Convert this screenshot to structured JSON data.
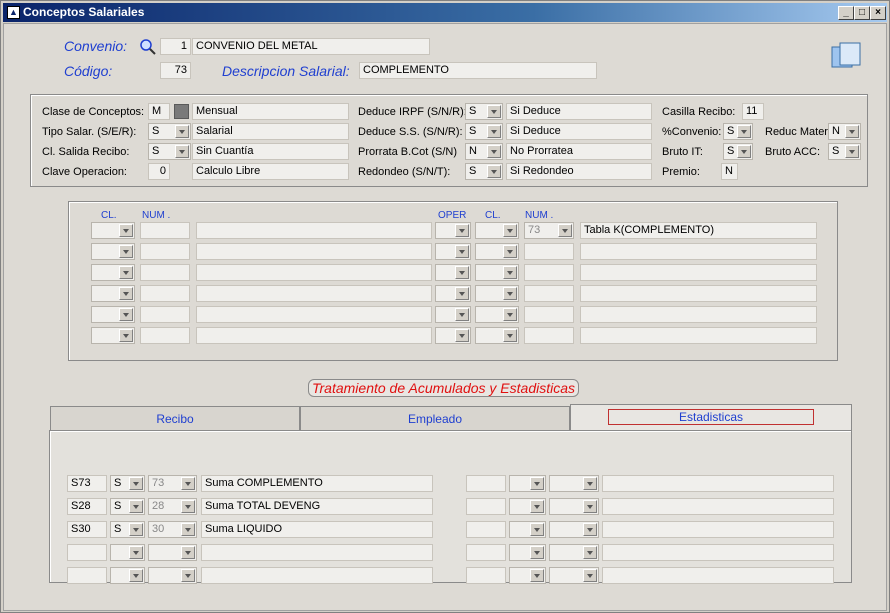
{
  "window": {
    "title": "Conceptos Salariales"
  },
  "header": {
    "convenio_label": "Convenio:",
    "convenio_code": "1",
    "convenio_name": "CONVENIO DEL METAL",
    "codigo_label": "Código:",
    "codigo_value": "73",
    "descripcion_label": "Descripcion Salarial:",
    "descripcion_value": "COMPLEMENTO"
  },
  "params": {
    "clase_label": "Clase de Conceptos:",
    "clase_value": "M",
    "clase_desc": "Mensual",
    "tipo_label": "Tipo Salar. (S/E/R):",
    "tipo_value": "S",
    "tipo_desc": "Salarial",
    "salida_label": "Cl. Salida Recibo:",
    "salida_value": "S",
    "salida_desc": "Sin Cuantía",
    "clave_label": "Clave Operacion:",
    "clave_value": "0",
    "clave_desc": "Calculo Libre",
    "irpf_label": "Deduce IRPF (S/N/R):",
    "irpf_value": "S",
    "irpf_desc": "Si Deduce",
    "ss_label": "Deduce S.S. (S/N/R):",
    "ss_value": "S",
    "ss_desc": "Si Deduce",
    "prorrata_label": "Prorrata B.Cot (S/N)",
    "prorrata_value": "N",
    "prorrata_desc": "No Prorratea",
    "redondeo_label": "Redondeo (S/N/T):",
    "redondeo_value": "S",
    "redondeo_desc": "Si Redondeo",
    "casilla_label": "Casilla Recibo:",
    "casilla_value": "11",
    "pconvenio_label": "%Convenio:",
    "pconvenio_value": "S",
    "brutoit_label": "Bruto IT:",
    "brutoit_value": "S",
    "premio_label": "Premio:",
    "premio_value": "N",
    "reduc_label": "Reduc Mater",
    "reduc_value": "N",
    "brutoacc_label": "Bruto ACC:",
    "brutoacc_value": "S"
  },
  "formula": {
    "headers": {
      "cl1": "CL.",
      "num1": "NUM .",
      "oper": "OPER",
      "cl2": "CL.",
      "num2": "NUM ."
    },
    "row0_num2": "73",
    "row0_desc": "Tabla K(COMPLEMENTO)"
  },
  "acumulados": {
    "title": "Tratamiento de Acumulados y Estadisticas",
    "tabs": [
      "Recibo",
      "Empleado",
      "Estadisticas"
    ],
    "rows": [
      {
        "code": "S73",
        "flag": "S",
        "num": "73",
        "desc": "Suma COMPLEMENTO"
      },
      {
        "code": "S28",
        "flag": "S",
        "num": "28",
        "desc": "Suma TOTAL DEVENG"
      },
      {
        "code": "S30",
        "flag": "S",
        "num": "30",
        "desc": "Suma LIQUIDO"
      }
    ]
  },
  "colors": {
    "accent_blue": "#1f3fd0",
    "title_red": "#e01010",
    "titlebar": "#0a246a"
  },
  "icons": [
    "app-icon",
    "search-icon",
    "minimize-icon",
    "maximize-icon",
    "close-icon",
    "document-icon",
    "dropdown-arrow-icon"
  ]
}
